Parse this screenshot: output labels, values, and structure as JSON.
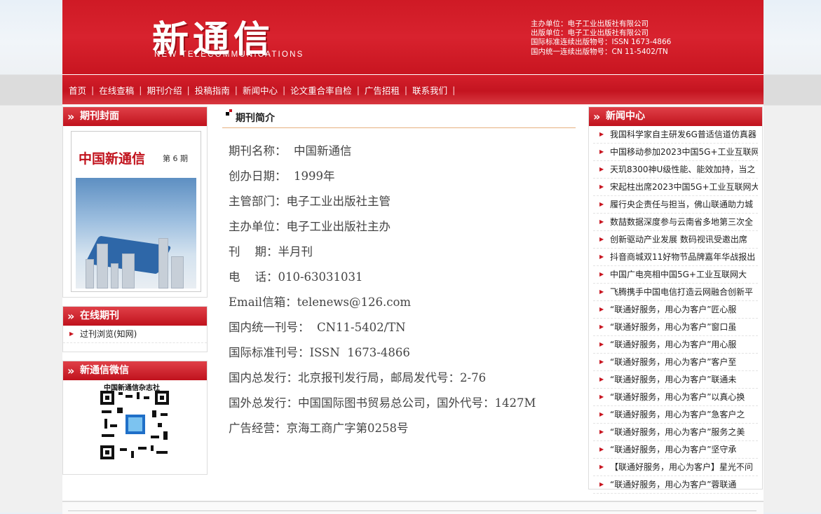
{
  "header": {
    "logo_cn": "新通信",
    "logo_en": "NEW TELECOMMUNICATIONS",
    "info": [
      "主办单位：电子工业出版社有限公司",
      "出版单位：电子工业出版社有限公司",
      "国际标准连续出版物号：ISSN 1673-4866",
      "国内统一连续出版物号：CN 11-5402/TN"
    ]
  },
  "nav": {
    "items": [
      "首页",
      "在线查稿",
      "期刊介绍",
      "投稿指南",
      "新闻中心",
      "论文重合率自检",
      "广告招租",
      "联系我们"
    ],
    "separator": "|"
  },
  "left": {
    "cover_title": "期刊封面",
    "cover": {
      "magazine_title": "中国新通信",
      "issue": "第 6 期"
    },
    "online_title": "在线期刊",
    "online_items": [
      "过刊浏览(知网)"
    ],
    "wechat_title": "新通信微信",
    "wechat_label": "中国新通信杂志社"
  },
  "main": {
    "title": "期刊简介",
    "lines": [
      "期刊名称：  中国新通信",
      "创办日期：  1999年",
      "主管部门：电子工业出版社主管",
      "主办单位：电子工业出版社主办",
      "刊    期：半月刊",
      "电    话：010-63031031",
      "Email信箱：telenews@126.com",
      "国内统一刊号：  CN11-5402/TN",
      "国际标准刊号：ISSN  1673-4866",
      "国内总发行：北京报刊发行局，邮局发代号：2-76",
      "国外总发行：中国国际图书贸易总公司，国外代号：1427M",
      "广告经营：京海工商广字第0258号"
    ]
  },
  "news": {
    "title": "新闻中心",
    "items": [
      "我国科学家自主研发6G普适信道仿真器",
      "中国移动参加2023中国5G+工业互联网",
      "天玑8300神U级性能、能效加持，当之",
      "宋起柱出席2023中国5G+工业互联网大",
      "履行央企责任与担当，佛山联通助力城",
      "数喆数据深度参与云南省多地第三次全",
      "创新驱动产业发展 数码视讯受邀出席",
      "抖音商城双11好物节品牌嘉年华战报出",
      "中国广电亮相中国5G+工业互联网大",
      "飞腾携手中国电信打造云网融合创新平",
      "“联通好服务，用心为客户”匠心服",
      "“联通好服务，用心为客户”窗口虽",
      "“联通好服务，用心为客户”用心服",
      "“联通好服务，用心为客户”客户至",
      "“联通好服务，用心为客户”联通未",
      "“联通好服务，用心为客户”以真心换",
      "“联通好服务，用心为客户”急客户之",
      "“联通好服务，用心为客户”服务之美",
      "“联通好服务，用心为客户”坚守承",
      "【联通好服务，用心为客户】星光不问",
      "“联通好服务，用心为客户”蓉联通"
    ]
  }
}
